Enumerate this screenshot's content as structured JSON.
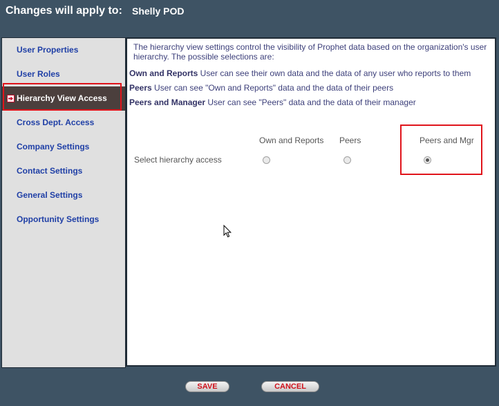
{
  "header": {
    "label": "Changes will apply to:",
    "value": "Shelly POD"
  },
  "sidebar": {
    "items": [
      {
        "label": "User Properties"
      },
      {
        "label": "User Roles"
      },
      {
        "label": "Hierarchy View Access",
        "active": true
      },
      {
        "label": "Cross Dept. Access"
      },
      {
        "label": "Company Settings"
      },
      {
        "label": "Contact Settings"
      },
      {
        "label": "General Settings"
      },
      {
        "label": "Opportunity Settings"
      }
    ]
  },
  "content": {
    "intro": "The hierarchy view settings control the visibility of Prophet data based on the organization's user hierarchy. The possible selections are:",
    "definitions": [
      {
        "term": "Own and Reports",
        "text": " User can see their own data and the data of any user who reports to them"
      },
      {
        "term": "Peers",
        "text": " User can see \"Own and Reports\" data and the data of their peers"
      },
      {
        "term": "Peers and Manager",
        "text": " User can see \"Peers\" data and the data of their manager"
      }
    ],
    "row_label": "Select hierarchy access",
    "options": [
      {
        "label": "Own and Reports",
        "checked": false
      },
      {
        "label": "Peers",
        "checked": false
      },
      {
        "label": "Peers and Mgr",
        "checked": true
      }
    ]
  },
  "footer": {
    "save_label": "SAVE",
    "cancel_label": "CANCEL"
  },
  "colors": {
    "frame": "#3e5364",
    "sidebar_bg": "#e0e0e0",
    "nav_link": "#1f3fa6",
    "active_bg": "#4b3f3d",
    "highlight": "#e0141b",
    "button_text": "#d0101b"
  },
  "icons": {
    "active_marker": "arrow-right-icon"
  }
}
